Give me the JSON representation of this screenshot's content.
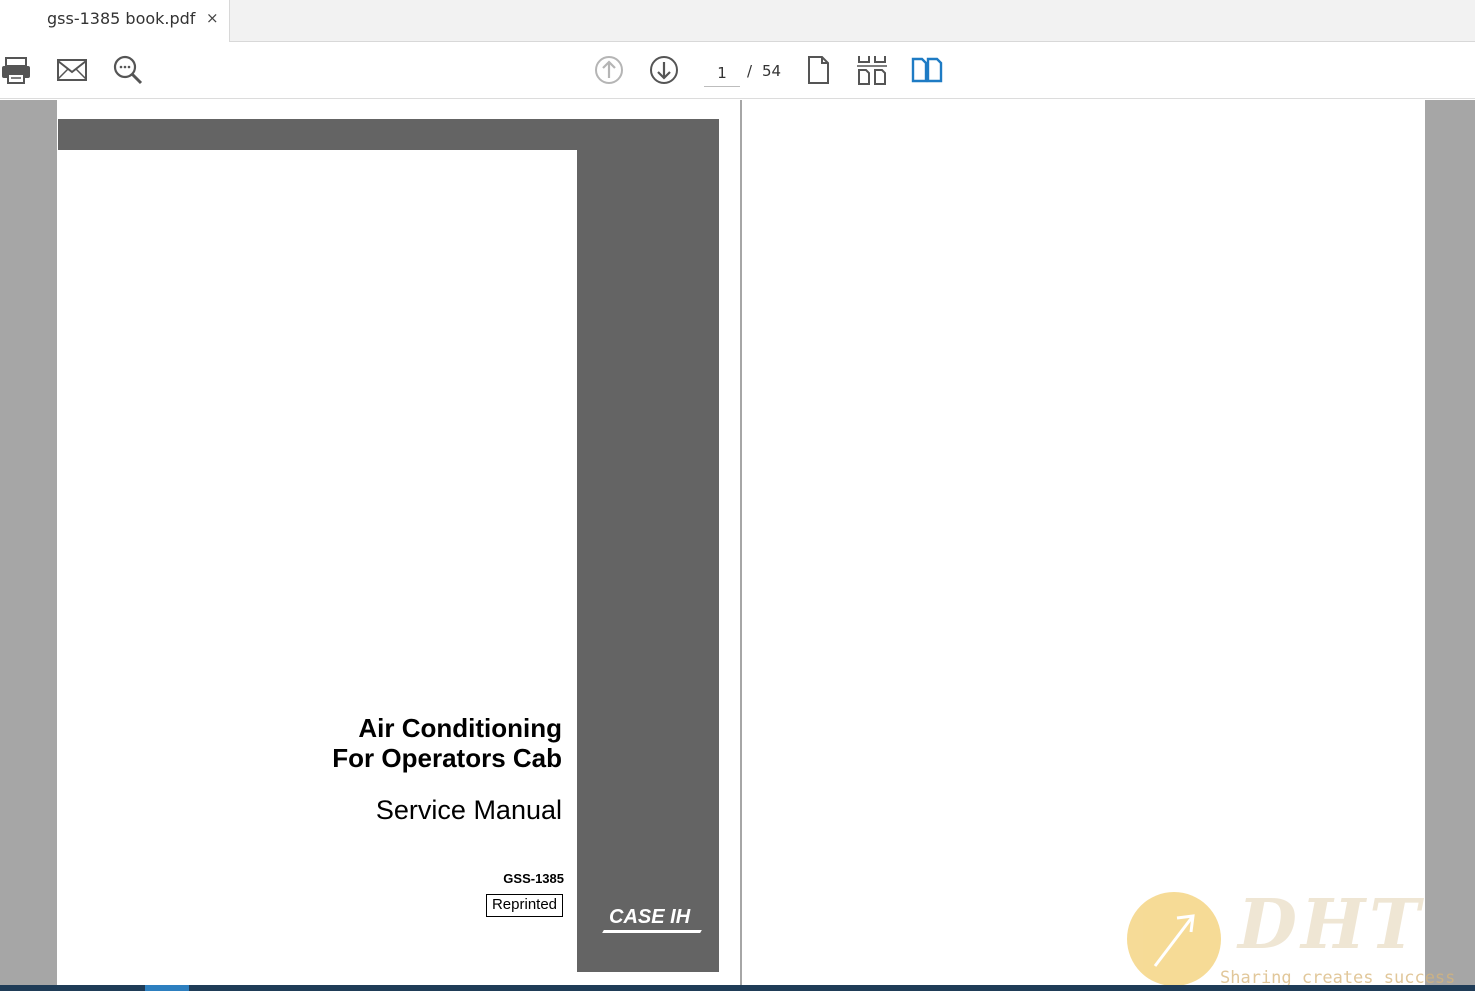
{
  "tab": {
    "title": "gss-1385 book.pdf",
    "close_glyph": "×"
  },
  "toolbar": {
    "icons": [
      "print-icon",
      "mail-icon",
      "zoom-icon",
      "previous-page-icon",
      "next-page-icon",
      "single-page-icon",
      "scroll-pages-icon",
      "two-page-icon"
    ],
    "page": {
      "current": "1",
      "separator": "/",
      "total": "54"
    },
    "active_color": "#1e7bc4"
  },
  "document": {
    "title_line1": "Air Conditioning",
    "title_line2": "For Operators Cab",
    "subtitle": "Service Manual",
    "doc_number": "GSS-1385",
    "badge": "Reprinted",
    "logo_text": "CASE",
    "logo_mark": "IH"
  },
  "watermark": {
    "logo": "DHT",
    "tagline": "Sharing creates success"
  }
}
